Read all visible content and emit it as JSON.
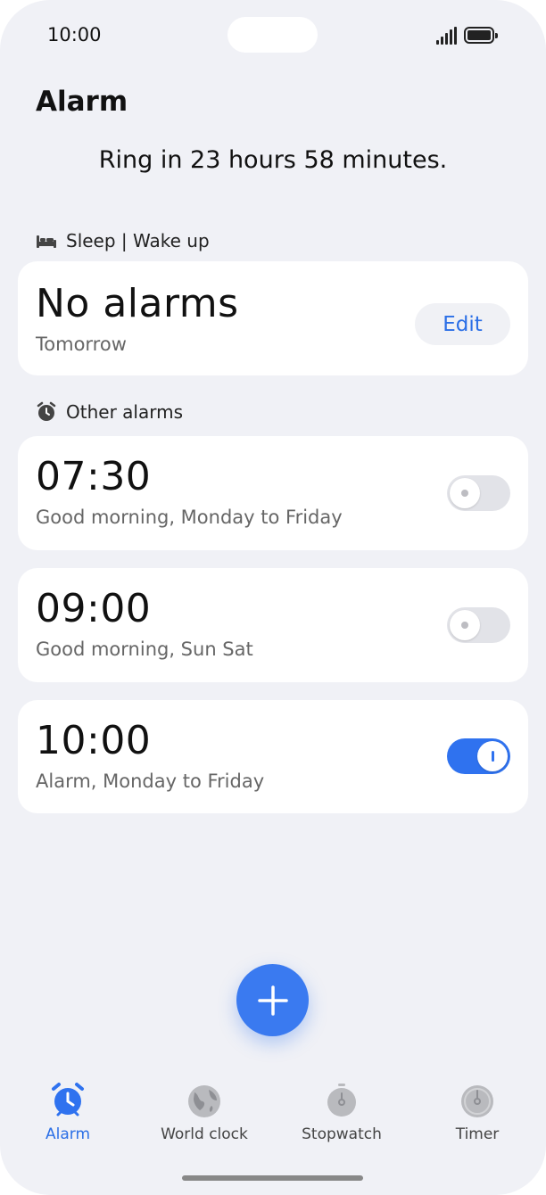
{
  "status_bar": {
    "time": "10:00"
  },
  "header": {
    "title": "Alarm",
    "next_ring": "Ring in 23 hours 58 minutes."
  },
  "sleep_section": {
    "label": "Sleep | Wake up",
    "card": {
      "title": "No alarms",
      "subtitle": "Tomorrow",
      "edit_label": "Edit"
    }
  },
  "other_section": {
    "label": "Other alarms",
    "alarms": [
      {
        "time": "07:30",
        "label": "Good morning, Monday to Friday",
        "enabled": false
      },
      {
        "time": "09:00",
        "label": "Good morning, Sun Sat",
        "enabled": false
      },
      {
        "time": "10:00",
        "label": "Alarm, Monday to Friday",
        "enabled": true
      }
    ]
  },
  "fab": {
    "icon": "plus-icon"
  },
  "tab_bar": {
    "active": "Alarm",
    "items": [
      {
        "label": "Alarm",
        "icon": "alarm-clock-icon"
      },
      {
        "label": "World clock",
        "icon": "globe-icon"
      },
      {
        "label": "Stopwatch",
        "icon": "stopwatch-icon"
      },
      {
        "label": "Timer",
        "icon": "timer-icon"
      }
    ]
  },
  "colors": {
    "accent": "#2f72ef",
    "background": "#f0f1f6",
    "card": "#ffffff"
  }
}
